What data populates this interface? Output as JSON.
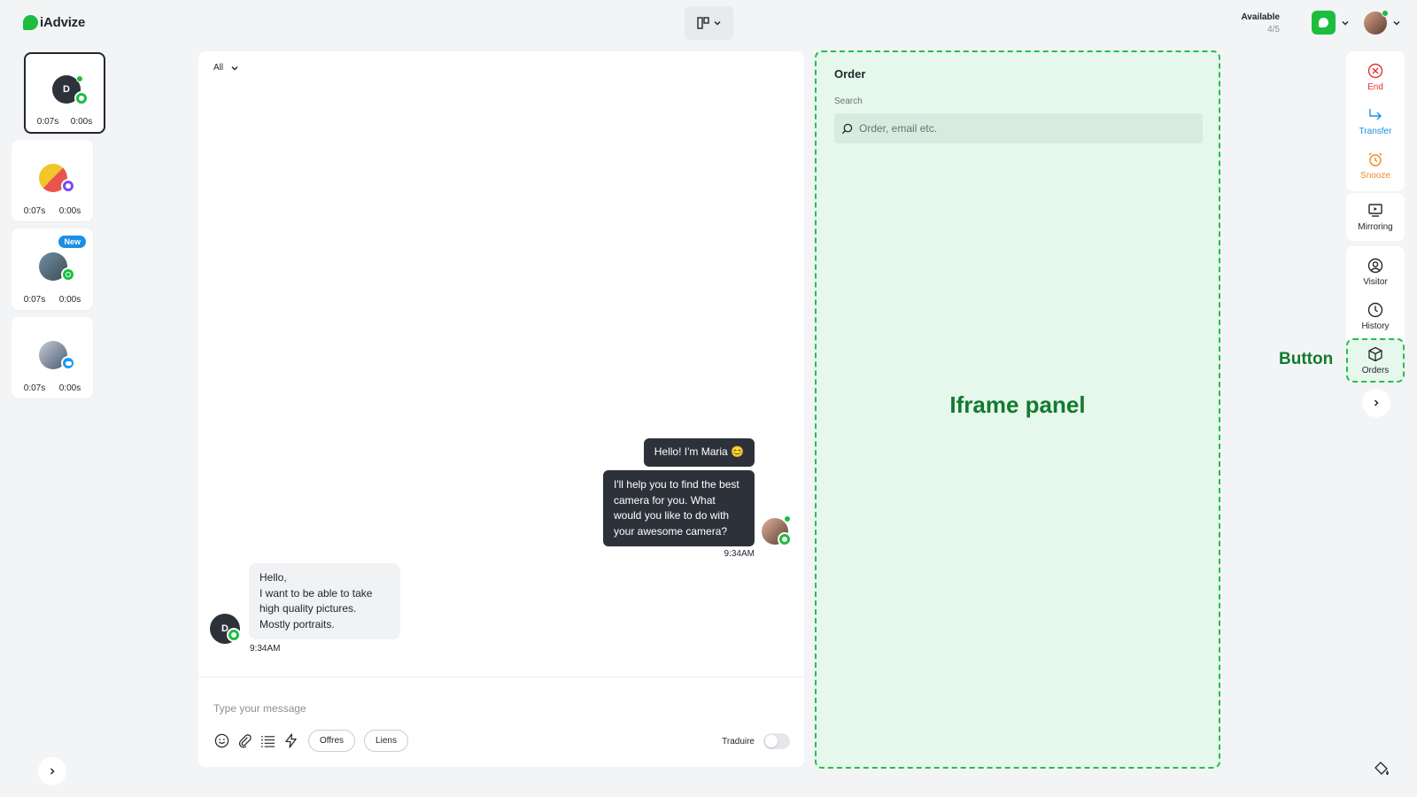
{
  "brand": {
    "name": "iAdvize"
  },
  "status": {
    "label": "Available",
    "count": "4/5",
    "color": "#1dbd3e"
  },
  "conversations": [
    {
      "initial": "D",
      "time_a": "0:07s",
      "time_b": "0:00s",
      "channel": "chat",
      "active": true
    },
    {
      "time_a": "0:07s",
      "time_b": "0:00s",
      "channel": "messenger"
    },
    {
      "time_a": "0:07s",
      "time_b": "0:00s",
      "channel": "whatsapp",
      "badge": "New"
    },
    {
      "time_a": "0:07s",
      "time_b": "0:00s",
      "channel": "twitter"
    }
  ],
  "chat": {
    "filter": "All",
    "messages": [
      {
        "from": "agent",
        "text": "Hello! I'm Maria 😊"
      },
      {
        "from": "agent",
        "text": "I'll help you to find the best camera for you. What would you like to do with your awesome camera?",
        "time": "9:34AM"
      },
      {
        "from": "visitor",
        "initial": "D",
        "text": "Hello,\nI want to be able to take high quality pictures.\nMostly portraits.",
        "time": "9:34AM"
      }
    ],
    "composer_placeholder": "Type your message",
    "pills": [
      "Offres",
      "Liens"
    ],
    "translate_label": "Traduire"
  },
  "iframe": {
    "title": "Order",
    "search_label": "Search",
    "search_placeholder": "Order, email etc.",
    "annotation": "Iframe panel"
  },
  "toolbar": {
    "end": "End",
    "transfer": "Transfer",
    "snooze": "Snooze",
    "mirroring": "Mirroring",
    "visitor": "Visitor",
    "history": "History",
    "orders": "Orders",
    "annotation": "Button"
  },
  "colors": {
    "accent": "#1dbd3e",
    "end": "#e5322d",
    "transfer": "#1a8fe3",
    "snooze": "#f08a24",
    "annotation": "#137a2e"
  }
}
